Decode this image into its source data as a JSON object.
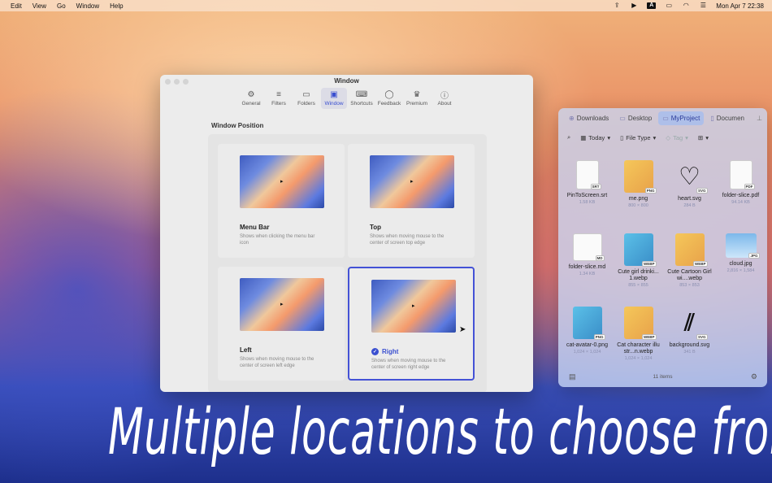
{
  "menubar": {
    "items": [
      "Edit",
      "View",
      "Go",
      "Window",
      "Help"
    ],
    "date_time": "Mon Apr 7  22:38",
    "icons": [
      "share-icon",
      "play-icon",
      "input-source-icon",
      "battery-icon",
      "wifi-icon",
      "control-center-icon"
    ]
  },
  "settings_window": {
    "title": "Window",
    "toolbar": [
      "General",
      "Filters",
      "Folders",
      "Window",
      "Shortcuts",
      "Feedback",
      "Premium",
      "About"
    ],
    "active_tab": "Window",
    "section_title": "Window Position",
    "options": [
      {
        "title": "Menu Bar",
        "desc": "Shows when clicking the menu bar icon",
        "selected": false
      },
      {
        "title": "Top",
        "desc": "Shows when moving mouse to the center of screen top edge",
        "selected": false
      },
      {
        "title": "Left",
        "desc": "Shows when moving mouse to the center of screen left edge",
        "selected": false
      },
      {
        "title": "Right",
        "desc": "Shows when moving mouse to the center of screen right edge",
        "selected": true
      }
    ]
  },
  "files_panel": {
    "tabs": [
      "Downloads",
      "Desktop",
      "MyProject",
      "Documen"
    ],
    "active_tab": "MyProject",
    "filters": {
      "date": "Today",
      "type": "File Type",
      "tag": "Tag"
    },
    "files": [
      {
        "name": "PinToScreen.srt",
        "meta": "1.58 KB",
        "badge": "SRT"
      },
      {
        "name": "me.png",
        "meta": "800 × 800",
        "badge": "PNG"
      },
      {
        "name": "heart.svg",
        "meta": "284 B",
        "badge": "SVG"
      },
      {
        "name": "folder-slice.pdf",
        "meta": "94.14 KB",
        "badge": "PDF"
      },
      {
        "name": "folder-slice.md",
        "meta": "1.34 KB",
        "badge": "MD"
      },
      {
        "name": "Cute girl drinki...1.webp",
        "meta": "855 × 855",
        "badge": "WEBP"
      },
      {
        "name": "Cute Cartoon Girl wi....webp",
        "meta": "853 × 853",
        "badge": "WEBP"
      },
      {
        "name": "cloud.jpg",
        "meta": "2,816 × 1,584",
        "badge": "JPG"
      },
      {
        "name": "cat-avatar-0.png",
        "meta": "1,024 × 1,024",
        "badge": "PNG"
      },
      {
        "name": "Cat character illustr...n.webp",
        "meta": "1,024 × 1,024",
        "badge": "WEBP"
      },
      {
        "name": "background.svg",
        "meta": "341 B",
        "badge": "SVG"
      }
    ],
    "count": "11 items"
  },
  "headline": "Multiple locations to choose from"
}
